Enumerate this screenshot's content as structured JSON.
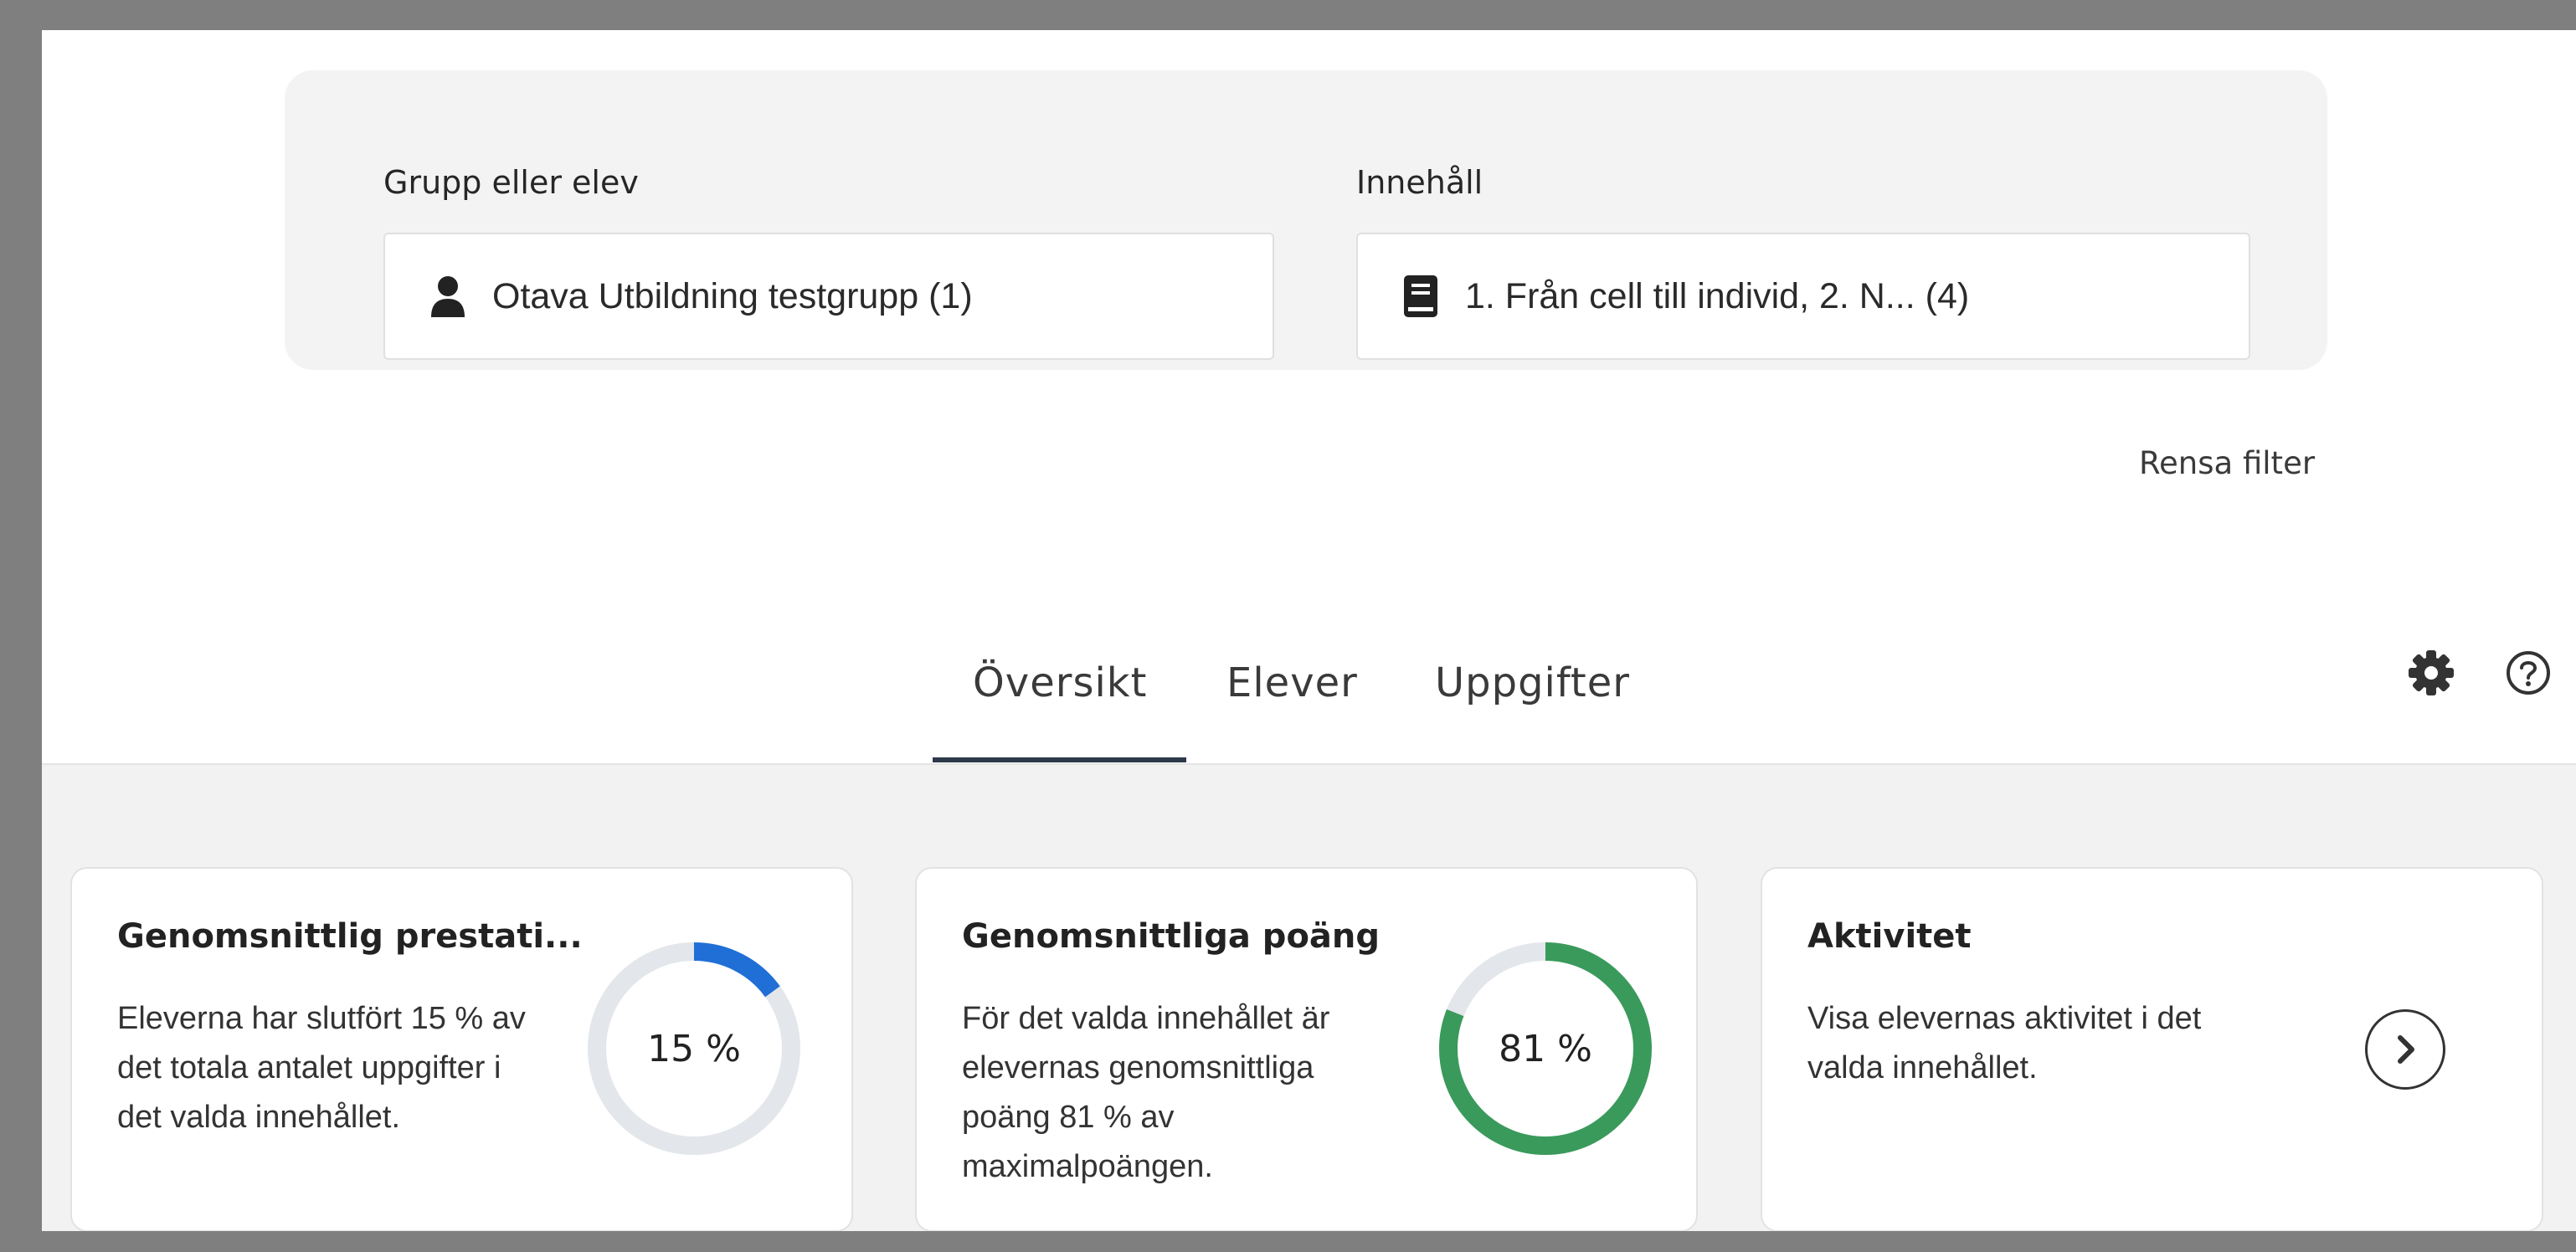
{
  "filters": {
    "group_label": "Grupp eller elev",
    "group_value": "Otava Utbildning testgrupp (1)",
    "content_label": "Innehåll",
    "content_value": "1. Från cell till individ, 2. N... (4)",
    "clear_label": "Rensa filter"
  },
  "tabs": [
    {
      "label": "Översikt",
      "active": true
    },
    {
      "label": "Elever",
      "active": false
    },
    {
      "label": "Uppgifter",
      "active": false
    }
  ],
  "header_icons": [
    "gear-icon",
    "help-icon"
  ],
  "cards": [
    {
      "title": "Genomsnittlig prestati...",
      "desc_lines": [
        "Eleverna har slutfört 15 % av",
        "det totala antalet uppgifter i",
        "det valda innehållet."
      ],
      "percent_label": "15 %",
      "percent_value": 15,
      "color": "#1f6fd6"
    },
    {
      "title": "Genomsnittliga poäng",
      "desc_lines": [
        "För det valda innehållet är",
        "elevernas genomsnittliga",
        "poäng 81 % av",
        "maximalpoängen."
      ],
      "percent_label": "81 %",
      "percent_value": 81,
      "color": "#3a9a5b"
    },
    {
      "title": "Aktivitet",
      "desc_lines": [
        "Visa elevernas aktivitet i det",
        "valda innehållet."
      ],
      "icon": "chevron-right-icon"
    }
  ],
  "colors": {
    "track": "#e3e6ea",
    "tab_underline": "#2d3a4a"
  }
}
